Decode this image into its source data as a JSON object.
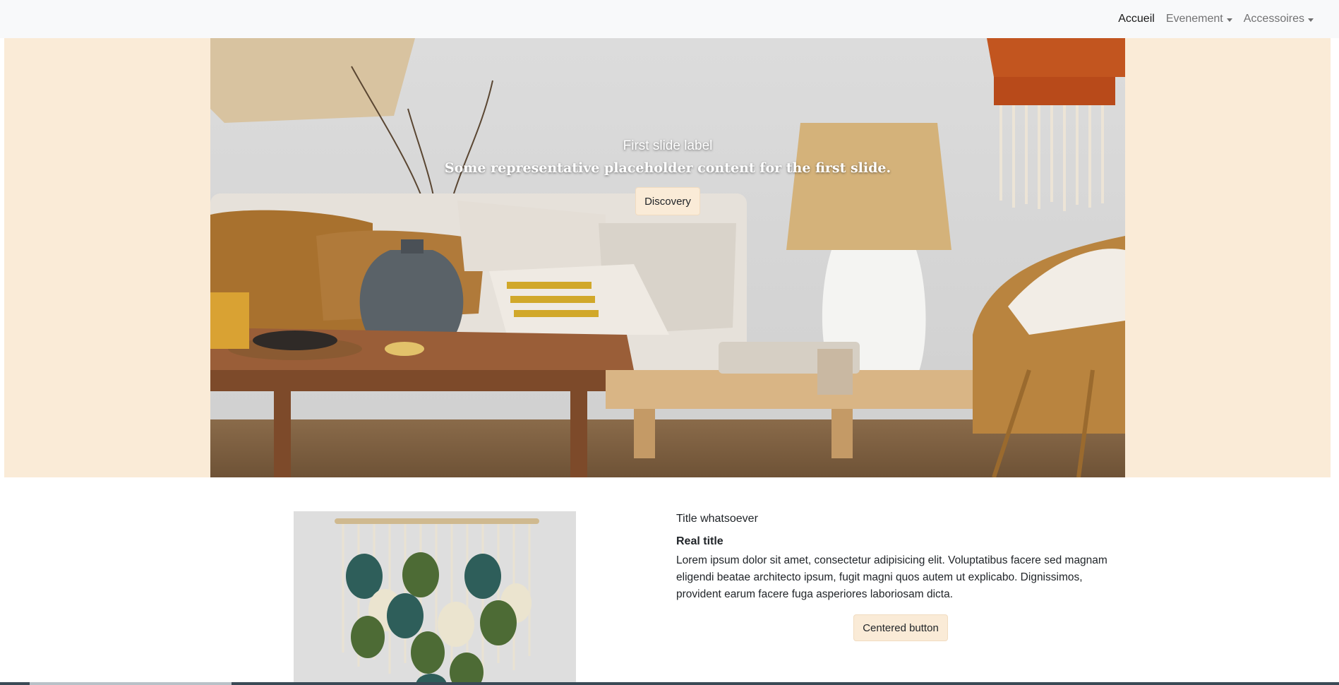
{
  "nav": {
    "items": [
      {
        "label": "Accueil",
        "active": true,
        "dropdown": false
      },
      {
        "label": "Evenement",
        "active": false,
        "dropdown": true
      },
      {
        "label": "Accessoires",
        "active": false,
        "dropdown": true
      }
    ]
  },
  "carousel": {
    "caption_title": "First slide label",
    "caption_text": "Some representative placeholder content for the first slide.",
    "button_label": "Discovery"
  },
  "feature": {
    "eyebrow": "Title whatsoever",
    "title": "Real title",
    "body": "Lorem ipsum dolor sit amet, consectetur adipisicing elit. Voluptatibus facere sed magnam eligendi beatae architecto ipsum, fugit magni quos autem ut explicabo. Dignissimos, provident earum facere fuga asperiores laboriosam dicta.",
    "button_label": "Centered button"
  },
  "colors": {
    "navbar_bg": "#f8f9fa",
    "hero_band": "#faebd7",
    "button_bg": "#faebd7"
  }
}
